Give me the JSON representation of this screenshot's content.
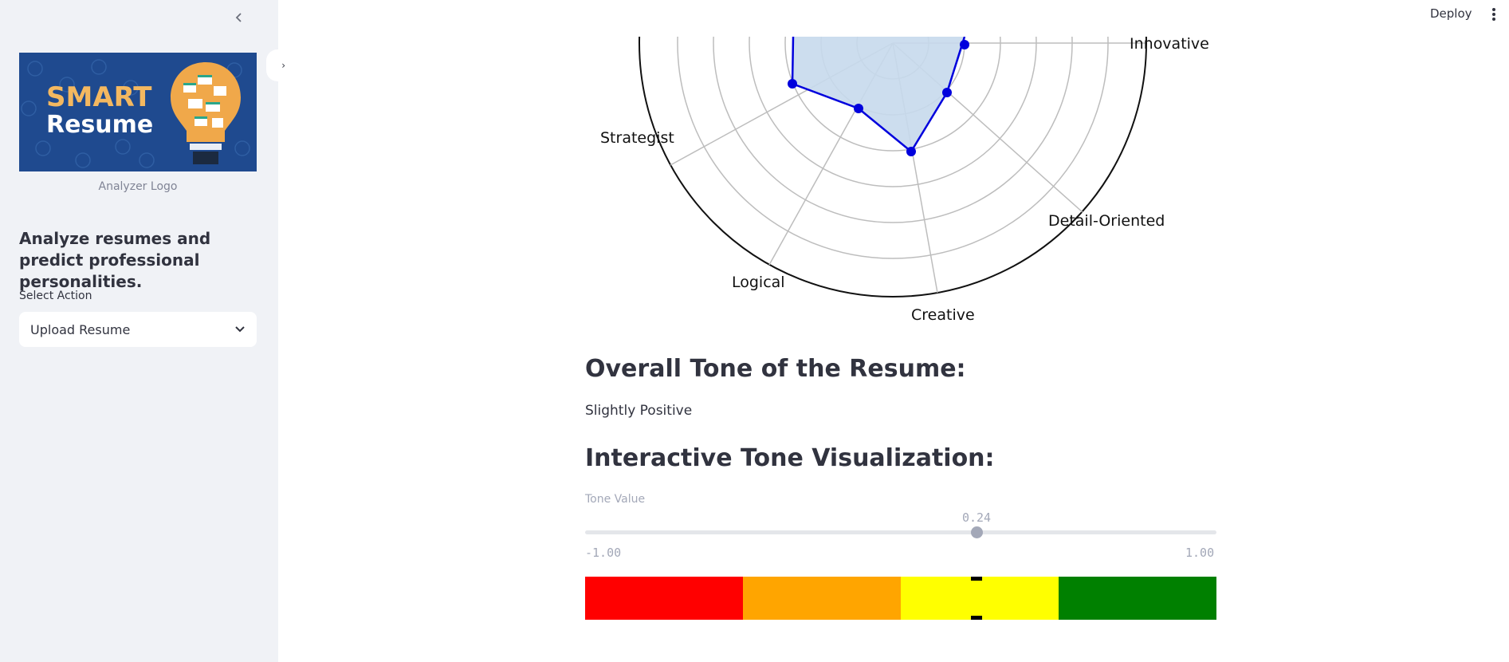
{
  "sidebar": {
    "logo": {
      "line1": "SMART",
      "line2": "Resume"
    },
    "logo_caption": "Analyzer Logo",
    "heading": "Analyze resumes and predict professional personalities.",
    "select_label": "Select Action",
    "select_value": "Upload Resume"
  },
  "header": {
    "deploy_label": "Deploy"
  },
  "main": {
    "tone_heading": "Overall Tone of the Resume:",
    "tone_value": "Slightly Positive",
    "viz_heading": "Interactive Tone Visualization:",
    "slider": {
      "label": "Tone Value",
      "value": 0.24,
      "value_text": "0.24",
      "min": -1.0,
      "max": 1.0,
      "min_text": "-1.00",
      "max_text": "1.00"
    },
    "gauge": {
      "segments": [
        "#ff0000",
        "#ffa500",
        "#ffff00",
        "#008000"
      ],
      "marker_value": 0.24
    }
  },
  "chart_data": {
    "type": "radar",
    "labels": {
      "innovative": "Innovative",
      "strategist": "Strategist",
      "detail": "Detail-Oriented",
      "logical": "Logical",
      "creative": "Creative"
    },
    "fill_color": "#c6d9ec",
    "line_color": "#0000dd",
    "grid_rings": 7
  }
}
